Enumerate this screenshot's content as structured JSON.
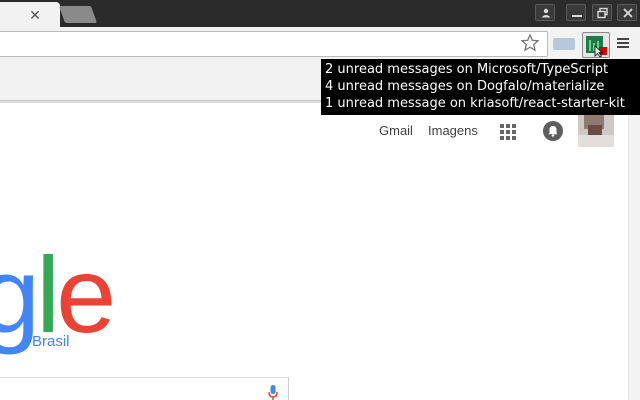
{
  "browser": {
    "tab_close_glyph": "✕",
    "window_controls": [
      "profile-icon",
      "minimize-icon",
      "restore-icon",
      "close-icon"
    ]
  },
  "toolbar": {
    "icons": [
      "star-icon",
      "extension-icon",
      "github-notifier-icon",
      "menu-icon"
    ]
  },
  "tooltip": {
    "lines": [
      "2 unread messages on Microsoft/TypeScript",
      "4 unread messages on Dogfalo/materialize",
      "1 unread message on kriasoft/react-starter-kit"
    ]
  },
  "google": {
    "links": [
      "Gmail",
      "Imagens"
    ],
    "logo_letters": [
      {
        "char": "g",
        "color": "#4285f4"
      },
      {
        "char": "l",
        "color": "#34a853"
      },
      {
        "char": "e",
        "color": "#ea4335"
      }
    ],
    "region_label": "Brasil",
    "icons": [
      "apps-grid-icon",
      "notifications-bell-icon",
      "avatar",
      "microphone-icon"
    ]
  },
  "colors": {
    "titlebar": "#2b2b2b",
    "toolbar": "#f2f2f2",
    "tooltip_bg": "#000000",
    "google_blue": "#4285f4",
    "google_green": "#34a853",
    "google_red": "#ea4335"
  }
}
